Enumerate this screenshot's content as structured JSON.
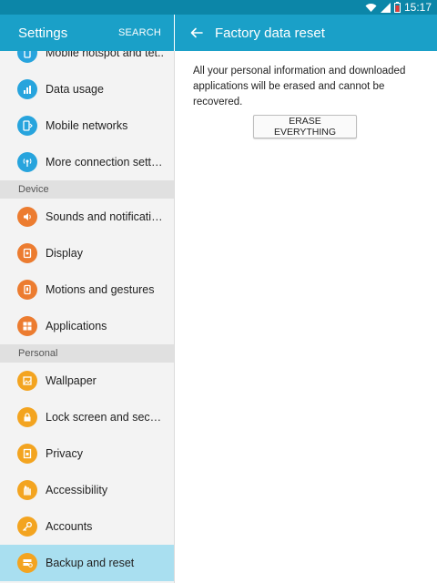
{
  "status_bar": {
    "time": "15:17",
    "icons": [
      "wifi-icon",
      "signal-icon",
      "battery-icon"
    ]
  },
  "colors": {
    "header_blue": "#1aa0c8",
    "status_blue": "#0c86a8",
    "selected_bg": "#a9dff0",
    "icon_blue": "#27a4dd",
    "icon_orange": "#ec7c30",
    "icon_amber": "#f3a420"
  },
  "left_header": {
    "title": "Settings",
    "search_label": "SEARCH"
  },
  "right_header": {
    "back_icon": "back-arrow-icon",
    "title": "Factory data reset"
  },
  "sidebar": {
    "items_top": [
      {
        "label": "Mobile hotspot and tet..",
        "icon": "hotspot-icon"
      },
      {
        "label": "Data usage",
        "icon": "data-usage-icon"
      },
      {
        "label": "Mobile networks",
        "icon": "mobile-networks-icon"
      },
      {
        "label": "More connection settin..",
        "icon": "more-connections-icon"
      }
    ],
    "section_device": "Device",
    "items_device": [
      {
        "label": "Sounds and notification..",
        "icon": "sound-icon"
      },
      {
        "label": "Display",
        "icon": "display-icon"
      },
      {
        "label": "Motions and gestures",
        "icon": "motions-icon"
      },
      {
        "label": "Applications",
        "icon": "applications-icon"
      }
    ],
    "section_personal": "Personal",
    "items_personal": [
      {
        "label": "Wallpaper",
        "icon": "wallpaper-icon"
      },
      {
        "label": "Lock screen and securi..",
        "icon": "lock-icon"
      },
      {
        "label": "Privacy",
        "icon": "privacy-icon"
      },
      {
        "label": "Accessibility",
        "icon": "accessibility-icon"
      },
      {
        "label": "Accounts",
        "icon": "key-icon"
      },
      {
        "label": "Backup and reset",
        "icon": "backup-icon",
        "selected": true
      }
    ]
  },
  "content": {
    "description": "All your personal information and downloaded applications will be erased and cannot be recovered.",
    "erase_button": "ERASE EVERYTHING"
  }
}
